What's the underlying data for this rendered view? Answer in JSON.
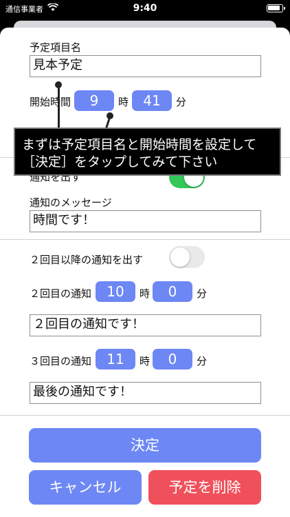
{
  "status": {
    "carrier": "通信事業者",
    "time": "9:40"
  },
  "form": {
    "name_label": "予定項目名",
    "name_value": "見本予定",
    "start_label": "開始時間",
    "start_hour": "9",
    "hour_unit": "時",
    "start_minute": "41",
    "minute_unit": "分",
    "notify_label": "通知を出す",
    "notify_on": true,
    "message_label": "通知のメッセージ",
    "message_value": "時間です！",
    "repeat_label": "２回目以降の通知を出す",
    "repeat_on": false,
    "second_label": "２回目の通知",
    "second_hour": "10",
    "second_minute": "0",
    "second_message": "２回目の通知です！",
    "third_label": "３回目の通知",
    "third_hour": "11",
    "third_minute": "0",
    "third_message": "最後の通知です！"
  },
  "buttons": {
    "confirm": "決定",
    "cancel": "キャンセル",
    "delete": "予定を削除"
  },
  "tooltip": {
    "line1": "まずは予定項目名と開始時間を設定して",
    "line2": "［決定］をタップしてみて下さい"
  },
  "colors": {
    "accent": "#6d87f4",
    "danger": "#f0505b",
    "toggle_on": "#34c759"
  }
}
